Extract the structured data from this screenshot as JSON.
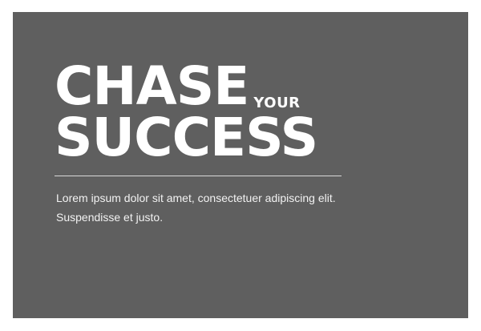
{
  "hero": {
    "headline_word1": "CHASE",
    "headline_small": "YOUR",
    "headline_word2": "SUCCESS",
    "body": "Lorem ipsum dolor sit amet, consectetuer adipiscing elit. Suspendisse et justo."
  },
  "colors": {
    "background": "#5f5f5f",
    "text": "#ffffff",
    "divider": "#d8d8d8"
  }
}
